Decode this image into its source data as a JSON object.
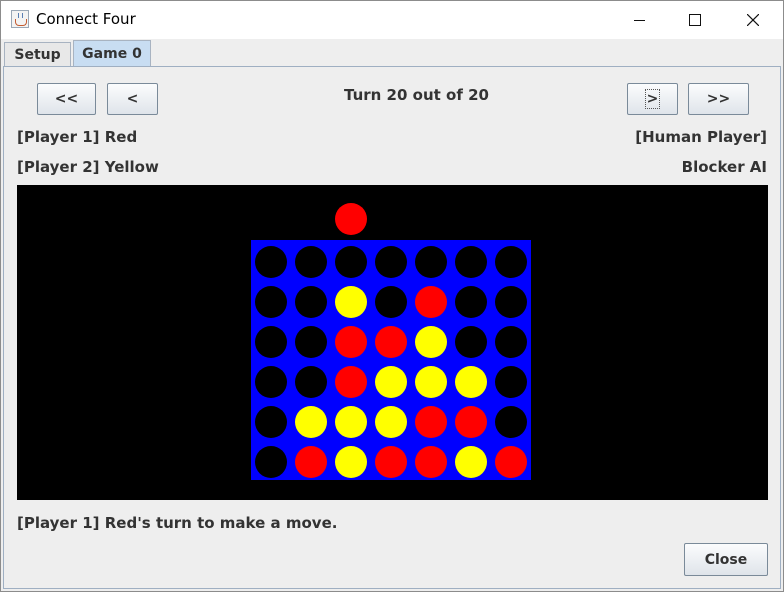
{
  "window": {
    "title": "Connect Four",
    "app_icon": "java-cup-icon"
  },
  "tabs": [
    {
      "label": "Setup",
      "selected": false
    },
    {
      "label": "Game 0",
      "selected": true
    }
  ],
  "nav": {
    "first_label": "<<",
    "prev_label": "<",
    "next_label": ">",
    "last_label": ">>",
    "turn_text": "Turn 20 out of 20"
  },
  "players": {
    "p1_label": "[Player 1] Red",
    "p1_type": "[Human Player]",
    "p2_label": "[Player 2] Yellow",
    "p2_type": "Blocker AI"
  },
  "board": {
    "rows": 6,
    "cols": 7,
    "hover_column": 2,
    "hover_piece": "R",
    "grid": [
      [
        "E",
        "E",
        "E",
        "E",
        "E",
        "E",
        "E"
      ],
      [
        "E",
        "E",
        "Y",
        "E",
        "R",
        "E",
        "E"
      ],
      [
        "E",
        "E",
        "R",
        "R",
        "Y",
        "E",
        "E"
      ],
      [
        "E",
        "E",
        "R",
        "Y",
        "Y",
        "Y",
        "E"
      ],
      [
        "E",
        "Y",
        "Y",
        "Y",
        "R",
        "R",
        "E"
      ],
      [
        "E",
        "R",
        "Y",
        "R",
        "R",
        "Y",
        "R"
      ]
    ],
    "colors": {
      "board": "#0000ff",
      "empty": "#000000",
      "red": "#ff0000",
      "yellow": "#ffff00",
      "background": "#000000"
    }
  },
  "status_text": "[Player 1] Red's turn to make a move.",
  "close_label": "Close"
}
